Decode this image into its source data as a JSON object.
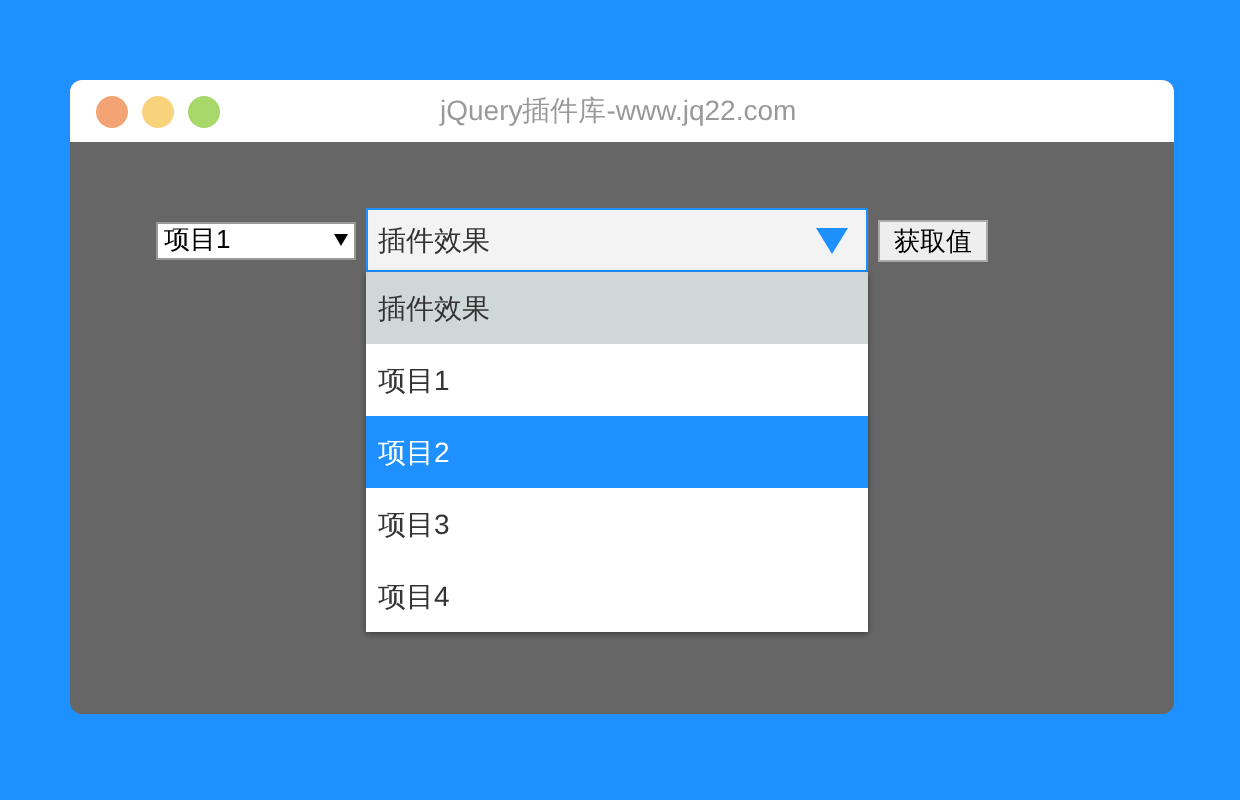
{
  "window": {
    "title": "jQuery插件库-www.jq22.com"
  },
  "native_select": {
    "value": "项目1"
  },
  "custom_select": {
    "value": "插件效果",
    "expanded": true,
    "options": [
      {
        "label": "插件效果",
        "selected": true,
        "hovered": false
      },
      {
        "label": "项目1",
        "selected": false,
        "hovered": false
      },
      {
        "label": "项目2",
        "selected": false,
        "hovered": true
      },
      {
        "label": "项目3",
        "selected": false,
        "hovered": false
      },
      {
        "label": "项目4",
        "selected": false,
        "hovered": false
      }
    ]
  },
  "button": {
    "label": "获取值"
  }
}
